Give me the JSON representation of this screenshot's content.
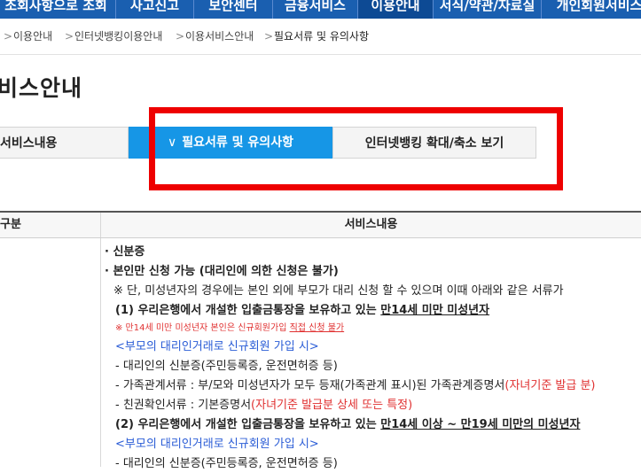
{
  "topnav": {
    "items": [
      {
        "label": "조회사항으로 조회"
      },
      {
        "label": "사고신고"
      },
      {
        "label": "보안센터"
      },
      {
        "label": "금융서비스"
      },
      {
        "label": "이용안내"
      },
      {
        "label": "서식/약관/자료실"
      },
      {
        "label": "개인회원서비스"
      }
    ]
  },
  "breadcrumb": {
    "items": [
      "이용안내",
      "인터넷뱅킹이용안내",
      "이용서비스안내",
      "필요서류 및 유의사항"
    ]
  },
  "page": {
    "title": "비스안내"
  },
  "tabs": {
    "service": "서비스내용",
    "docs": "필요서류 및 유의사항",
    "expand": "인터넷뱅킹 확대/축소 보기"
  },
  "table": {
    "col_gubun": "구분",
    "col_service": "서비스내용"
  },
  "content": {
    "l1": "· 신분증",
    "l2": "· 본인만 신청 가능 (대리인에 의한 신청은 불가)",
    "l3": "※ 단, 미성년자의 경우에는 본인 외에 부모가 대리 신청 할 수 있으며 이때 아래와 같은 서류가",
    "l4a": "(1) 우리은행에서 개설한 입출금통장을 보유하고 있는 ",
    "l4b": "만14세 미만 미성년자",
    "l5a": "※ 만14세 미만 미성년자 본인은 신규회원가입 ",
    "l5b": "직접 신청 불가",
    "l6": "<부모의 대리인거래로 신규회원 가입 시>",
    "l7": "- 대리인의 신분증(주민등록증, 운전면허증 등)",
    "l8a": "- 가족관계서류 : 부/모와 미성년자가 모두 등재(가족관계 표시)된 가족관계증명서",
    "l8b": "(자녀기준 발급 분)",
    "l9a": "- 친권확인서류 : 기본증명서",
    "l9b": "(자녀기준 발급분 상세 또는 특정)",
    "l10a": "(2) 우리은행에서 개설한 입출금통장을 보유하고 있는 ",
    "l10b": "만14세 이상 ~ 만19세 미만의 미성년자",
    "l11": "<부모의 대리인거래로 신규회원 가입 시>",
    "l12": "- 대리인의 신분증(주민등록증, 운전면허증 등)"
  },
  "colors": {
    "nav_bg": "#1a5fb0",
    "tab_active": "#1696e6",
    "highlight_box": "#ee0000",
    "link_blue": "#2a5cd6",
    "note_red": "#e03030"
  }
}
